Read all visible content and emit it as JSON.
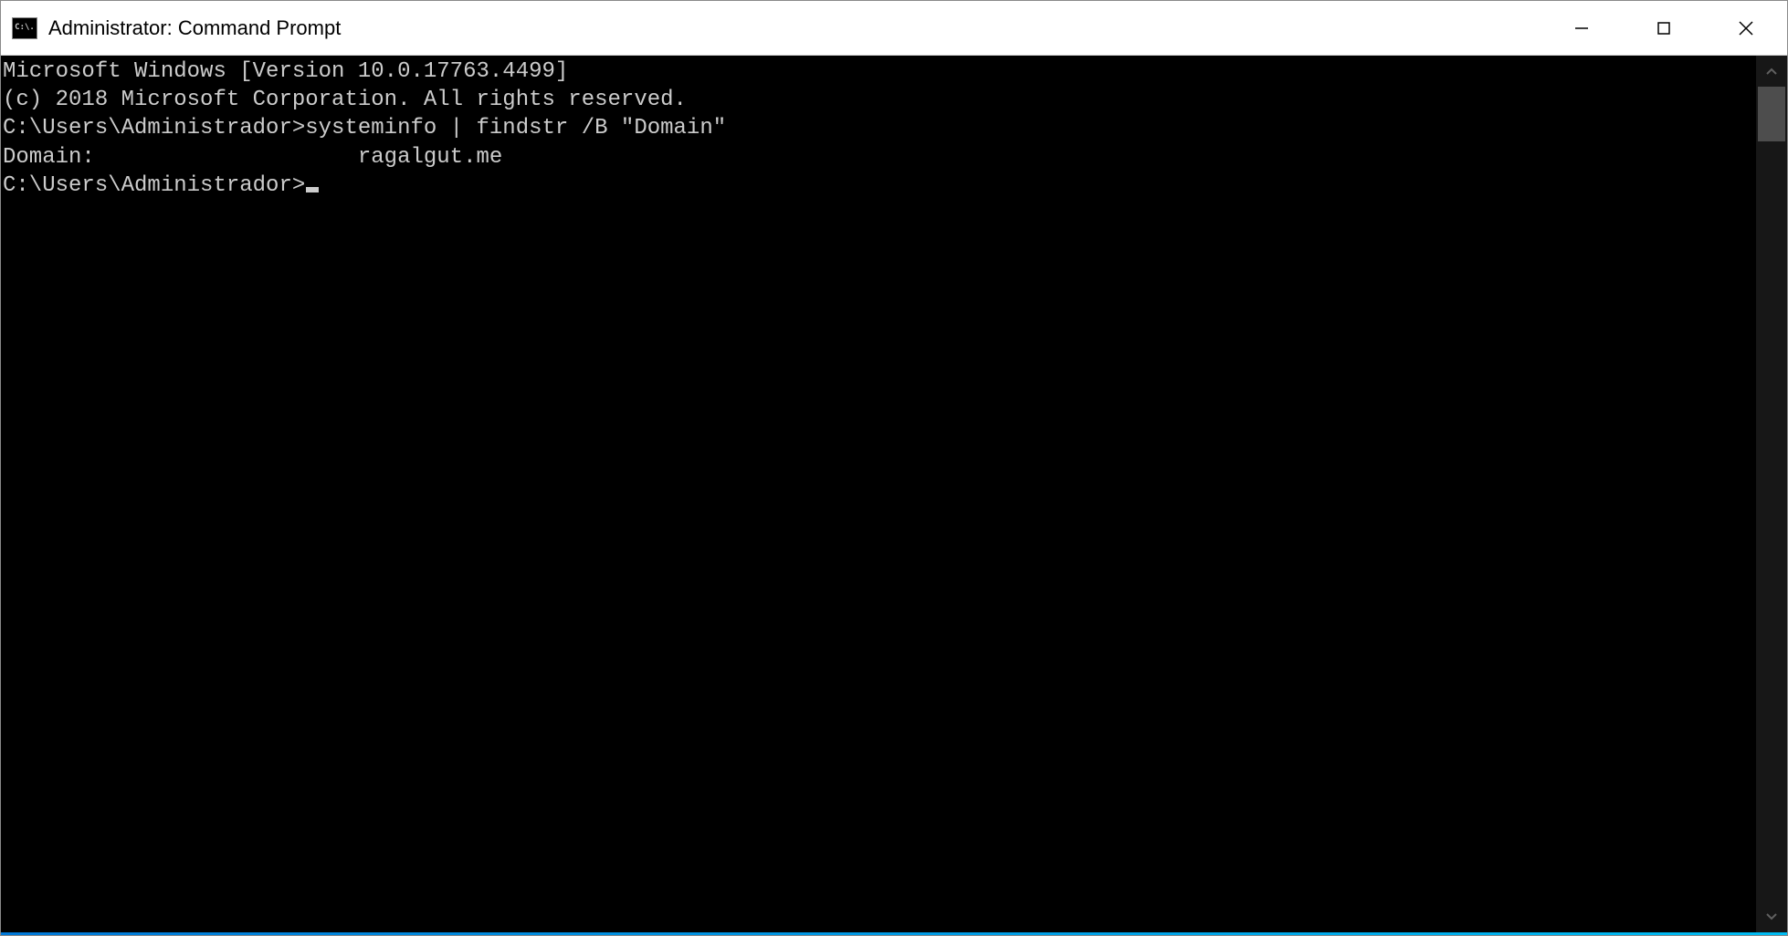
{
  "window": {
    "title": "Administrator: Command Prompt",
    "icon_label": "C:\\."
  },
  "terminal": {
    "lines": [
      "Microsoft Windows [Version 10.0.17763.4499]",
      "(c) 2018 Microsoft Corporation. All rights reserved.",
      "",
      "C:\\Users\\Administrador>systeminfo | findstr /B \"Domain\"",
      "Domain:                    ragalgut.me",
      ""
    ],
    "prompt": "C:\\Users\\Administrador>"
  }
}
